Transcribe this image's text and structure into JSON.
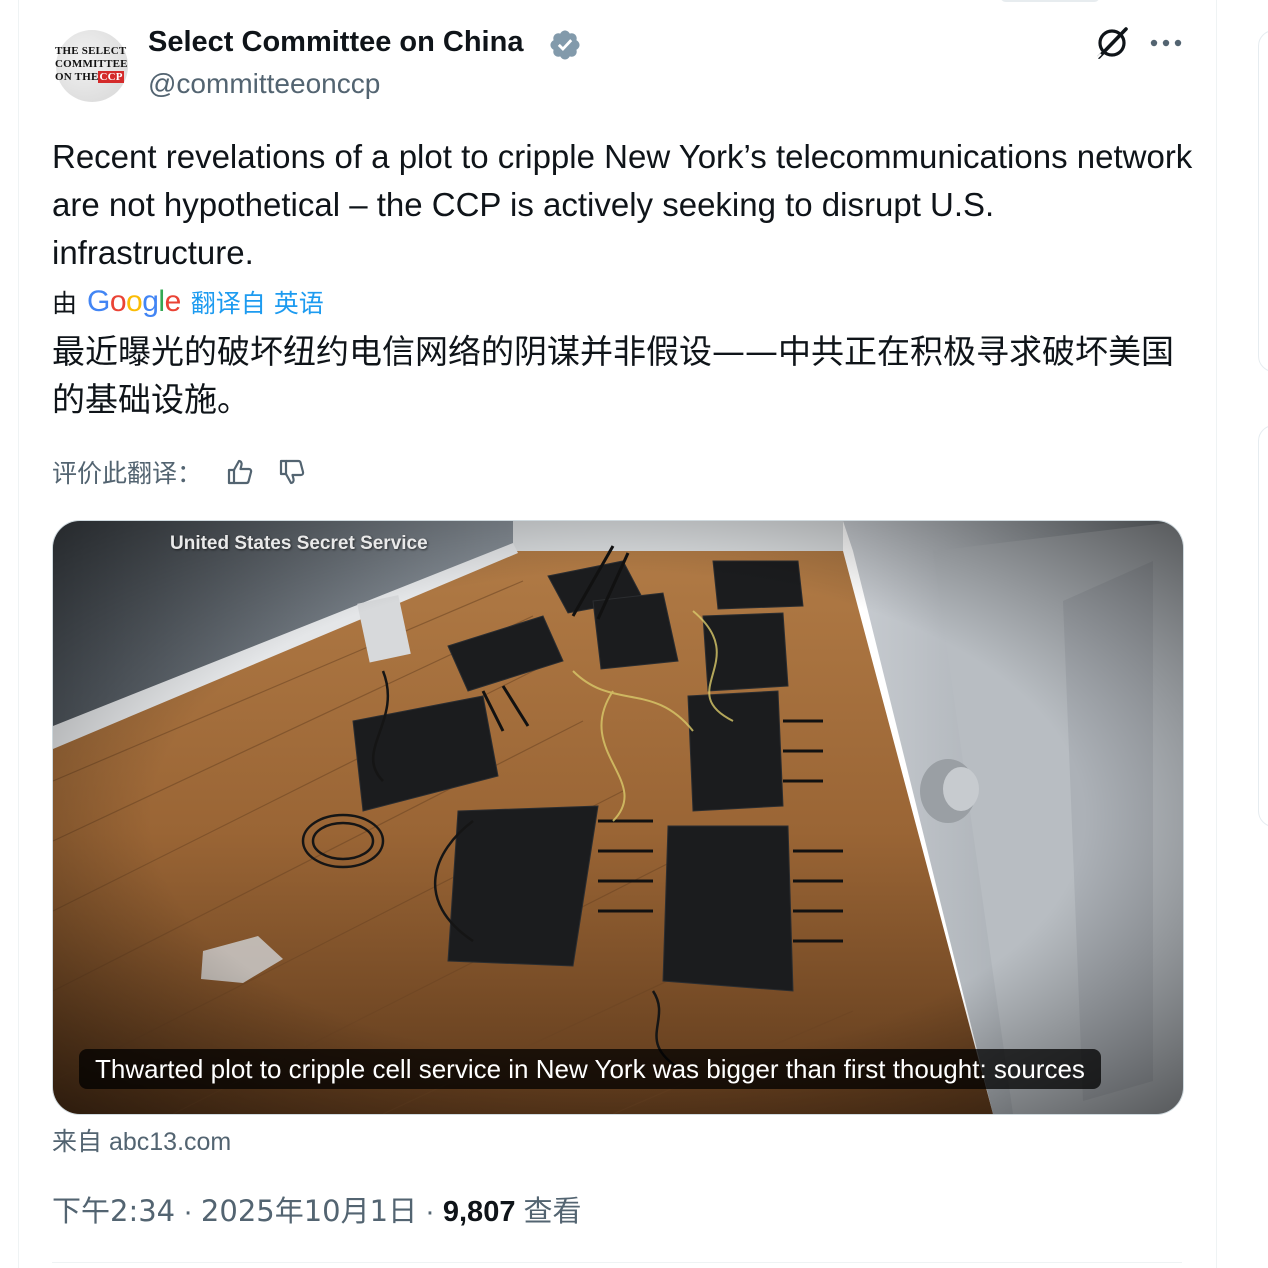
{
  "author": {
    "name": "Select Committee on China",
    "handle": "@committeeonccp",
    "avatar_text": [
      "THE SELECT",
      "COMMITTEE",
      "ON THE",
      "CCP"
    ],
    "verified_icon": "verified-badge-icon"
  },
  "actions": {
    "grok_icon": "grok-icon",
    "more_icon": "more-icon"
  },
  "tweet": {
    "text": "Recent revelations of a plot to cripple New York’s telecommunications network are not hypothetical – the CCP is actively seeking to disrupt U.S. infrastructure."
  },
  "translation": {
    "by_label": "由",
    "provider": "Google",
    "link_label": "翻译自 英语",
    "text": "最近曝光的破坏纽约电信网络的阴谋并非假设——中共正在积极寻求破坏美国的基础设施。",
    "rate_label": "评价此翻译：",
    "thumbs_up_icon": "thumbs-up-icon",
    "thumbs_down_icon": "thumbs-down-icon"
  },
  "media": {
    "watermark": "United States Secret Service",
    "caption": "Thwarted plot to cripple cell service in New York was bigger than first thought: sources"
  },
  "source": {
    "prefix": "来自",
    "domain": "abc13.com"
  },
  "meta": {
    "time": "下午2:34",
    "separator": "·",
    "date": "2025年10月1日",
    "views_count": "9,807",
    "views_label": "查看"
  },
  "colors": {
    "text_primary": "#0f1419",
    "text_secondary": "#536471",
    "link_blue": "#1d9bf0",
    "verified_gray": "#829aab"
  }
}
